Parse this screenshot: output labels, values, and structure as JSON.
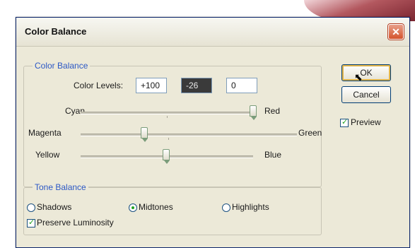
{
  "dialog": {
    "title": "Color Balance",
    "close_glyph": "✕"
  },
  "color_balance": {
    "legend": "Color Balance",
    "levels_label": "Color Levels:",
    "levels": [
      "+100",
      "-26",
      "0"
    ],
    "sliders": [
      {
        "left": "Cyan",
        "right": "Red",
        "value": 100
      },
      {
        "left": "Magenta",
        "right": "Green",
        "value": -26
      },
      {
        "left": "Yellow",
        "right": "Blue",
        "value": 0
      }
    ]
  },
  "tone_balance": {
    "legend": "Tone Balance",
    "options": [
      "Shadows",
      "Midtones",
      "Highlights"
    ],
    "selected": "Midtones",
    "preserve_luminosity_label": "Preserve Luminosity",
    "preserve_luminosity_checked": true
  },
  "buttons": {
    "ok": "OK",
    "cancel": "Cancel"
  },
  "preview": {
    "label": "Preview",
    "checked": true
  }
}
